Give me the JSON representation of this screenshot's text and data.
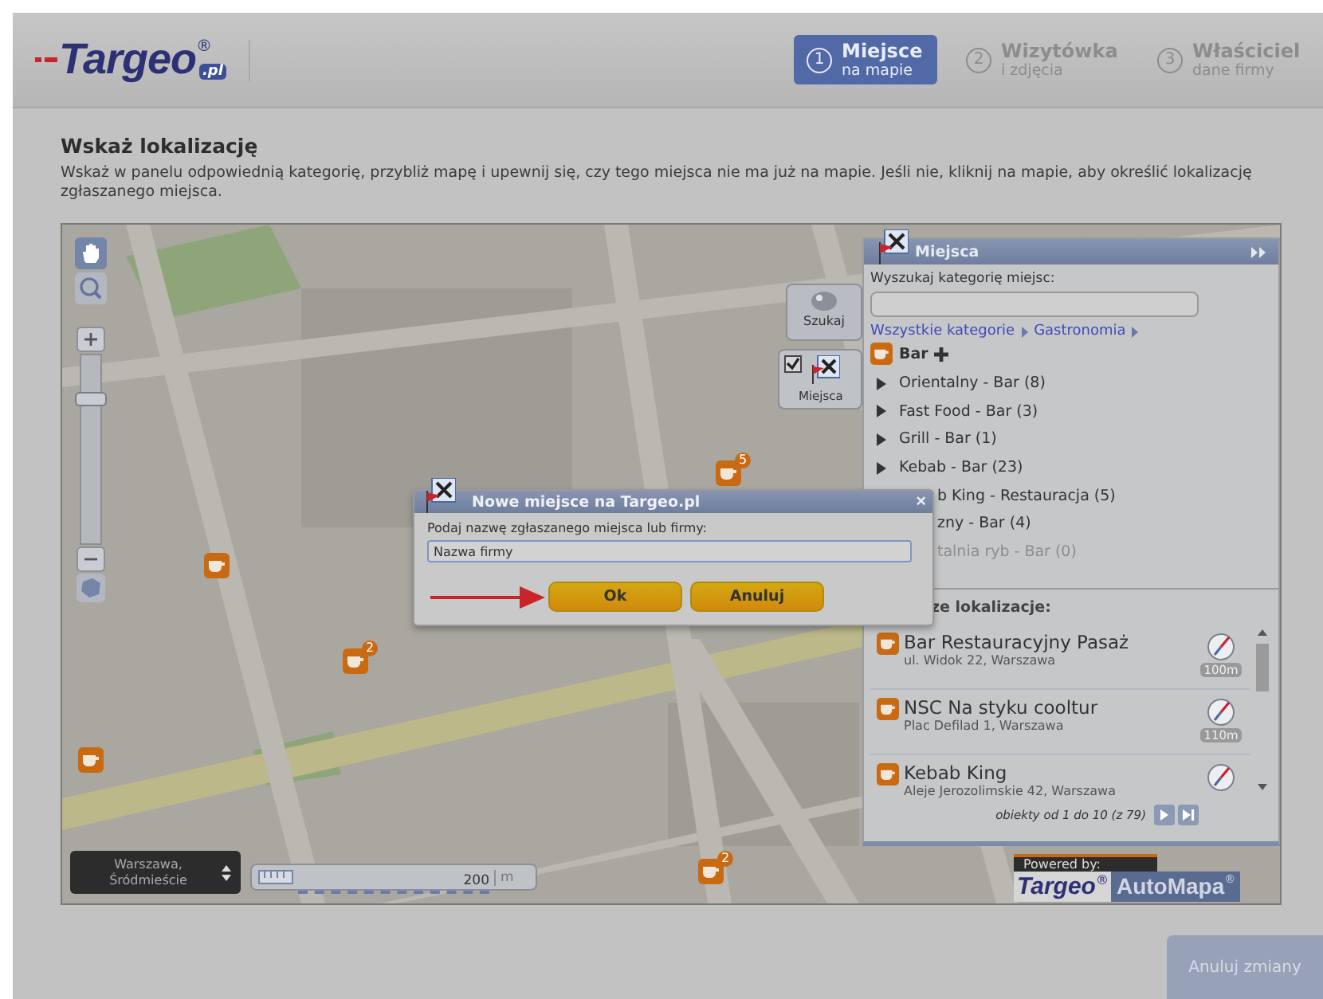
{
  "header": {
    "logo": {
      "name": "Targeo",
      "mark": "®",
      "domain": ".pl"
    },
    "steps": [
      {
        "number": "1",
        "title": "Miejsce",
        "subtitle": "na mapie",
        "selected": true
      },
      {
        "number": "2",
        "title": "Wizytówka",
        "subtitle": "i zdjęcia",
        "selected": false
      },
      {
        "number": "3",
        "title": "Właściciel",
        "subtitle": "dane firmy",
        "selected": false
      }
    ]
  },
  "intro": {
    "title": "Wskaż lokalizację",
    "text": "Wskaż w panelu odpowiednią kategorię, przybliż mapę i upewnij się, czy tego miejsca nie ma już na mapie. Jeśli nie, kliknij na mapie, aby określić lokalizację zgłaszanego miejsca."
  },
  "map": {
    "zoom": {
      "level": 0.77
    },
    "search_button": {
      "label": "Szukaj"
    },
    "places_toggle": {
      "label": "Miejsca",
      "checked": true
    },
    "location": {
      "label": "Warszawa, Śródmieście"
    },
    "scale": {
      "value": "200",
      "unit": "m"
    },
    "markers": [
      {
        "kind": "single"
      },
      {
        "kind": "cluster",
        "badge": "2"
      },
      {
        "kind": "cluster",
        "badge": "5"
      },
      {
        "kind": "single"
      },
      {
        "kind": "cluster",
        "badge": "2"
      }
    ],
    "panel": {
      "title": "Miejsca",
      "search_label": "Wyszukaj kategorię miejsc:",
      "breadcrumb": [
        "Wszystkie kategorie",
        "Gastronomia"
      ],
      "category": "Bar",
      "subcategories": [
        {
          "kind": "full",
          "label": "Orientalny - Bar (8)",
          "disabled": false
        },
        {
          "kind": "full",
          "label": "Fast Food - Bar (3)",
          "disabled": false
        },
        {
          "kind": "full",
          "label": "Grill - Bar (1)",
          "disabled": false
        },
        {
          "kind": "full",
          "label": "Kebab - Bar (23)",
          "disabled": false
        },
        {
          "kind": "partial",
          "label": "b King - Restauracja (5)",
          "disabled": false
        },
        {
          "kind": "partial",
          "label": "zny - Bar (4)",
          "disabled": false
        },
        {
          "kind": "partial",
          "label": "talnia ryb - Bar (0)",
          "disabled": true
        }
      ],
      "nearby": {
        "title": "ze lokalizacje:",
        "clipped": true,
        "results": [
          {
            "name": "Bar Restauracyjny Pasaż",
            "address": "ul. Widok 22, Warszawa",
            "distance": "100m"
          },
          {
            "name": "NSC Na styku cooltur",
            "address": "Plac Defilad 1, Warszawa",
            "distance": "110m"
          },
          {
            "name": "Kebab King",
            "address": "Aleje Jerozolimskie 42, Warszawa"
          }
        ]
      },
      "pagination": "obiekty od 1 do 10 (z 79)"
    },
    "powered": {
      "label": "Powered by:",
      "brand": "Targeo",
      "brand_mark": "®",
      "partner": "AutoMapa",
      "partner_mark": "®"
    },
    "dialog": {
      "title": "Nowe miejsce na Targeo.pl",
      "close": "×",
      "label": "Podaj nazwę zgłaszanego miejsca lub firmy:",
      "value": "Nazwa firmy",
      "buttons": [
        "Ok",
        "Anuluj"
      ]
    }
  },
  "footer": {
    "button": "Anuluj zmiany"
  }
}
